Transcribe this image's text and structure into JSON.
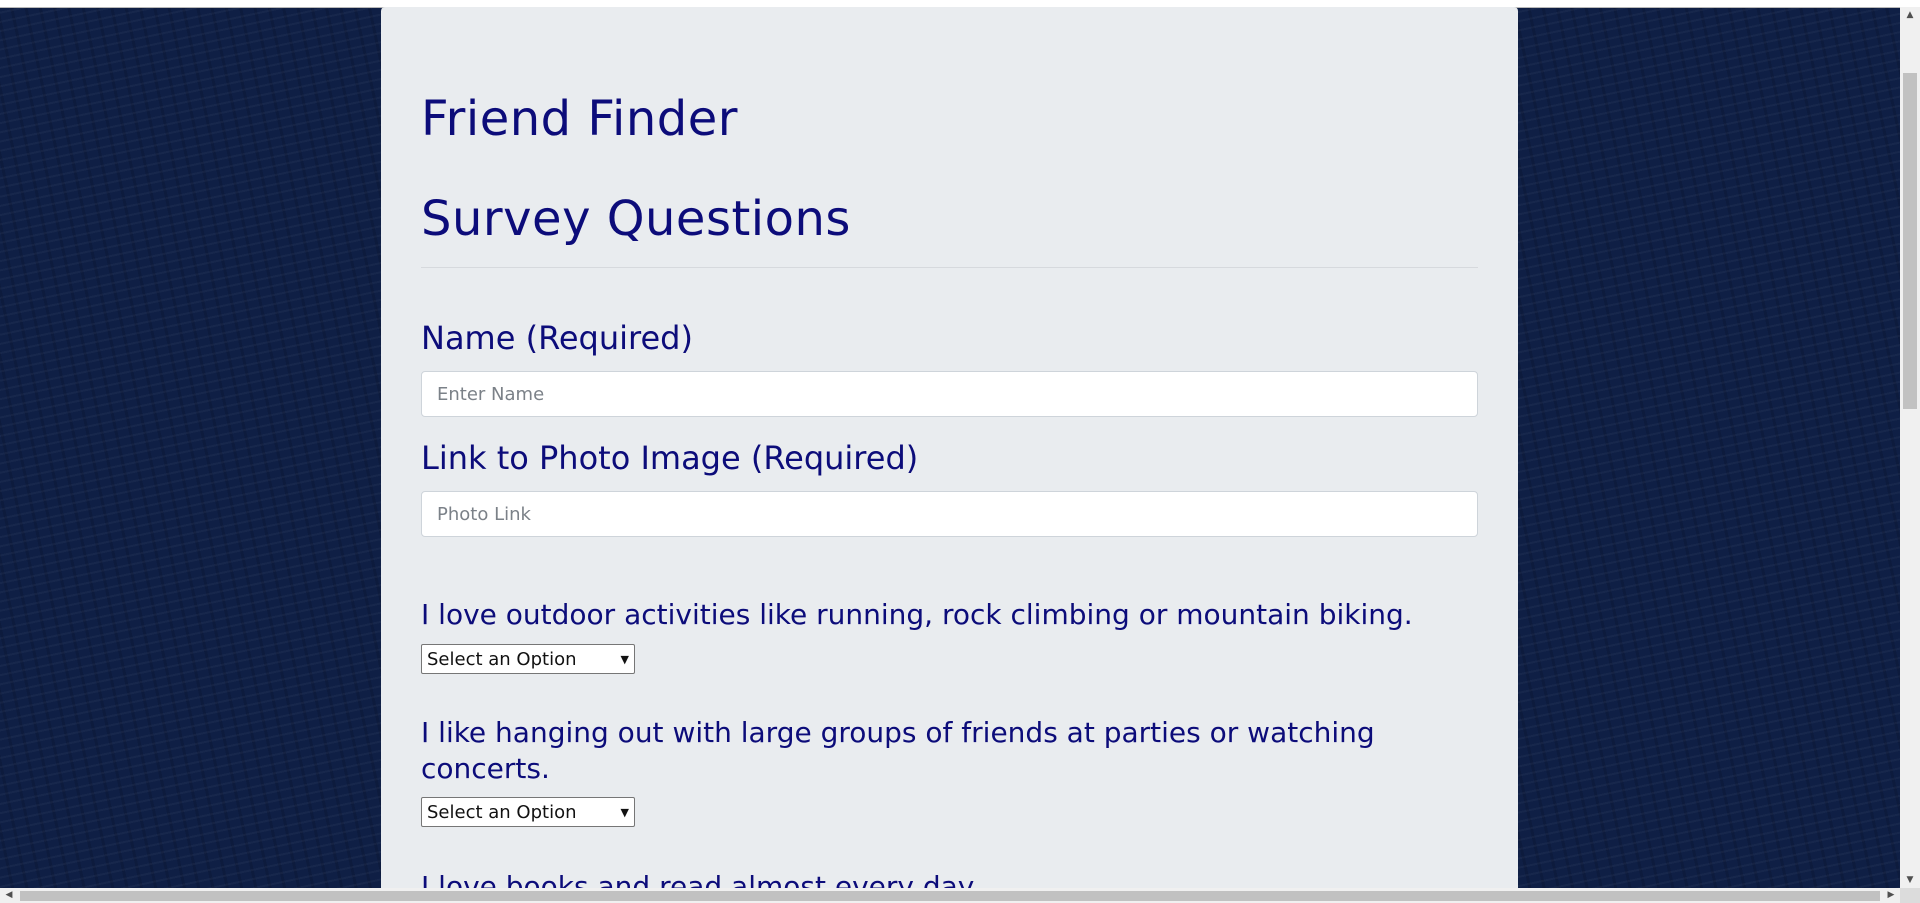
{
  "header": {
    "app_title": "Friend Finder",
    "section_title": "Survey Questions"
  },
  "form": {
    "name": {
      "label": "Name (Required)",
      "placeholder": "Enter Name",
      "value": ""
    },
    "photo": {
      "label": "Link to Photo Image (Required)",
      "placeholder": "Photo Link",
      "value": ""
    },
    "questions": [
      {
        "text": "I love outdoor activities like running, rock climbing or mountain biking.",
        "selected": "Select an Option"
      },
      {
        "text": "I like hanging out with large groups of friends at parties or watching concerts.",
        "selected": "Select an Option"
      },
      {
        "text": "I love books and read almost every day."
      }
    ]
  },
  "scrollbars": {
    "up_icon": "arrow-up-icon",
    "down_icon": "arrow-down-icon",
    "left_icon": "arrow-left-icon",
    "right_icon": "arrow-right-icon"
  },
  "colors": {
    "page_background": "#0f1f45",
    "panel_background": "#e9ecef",
    "heading_color": "#0c0c7a"
  }
}
